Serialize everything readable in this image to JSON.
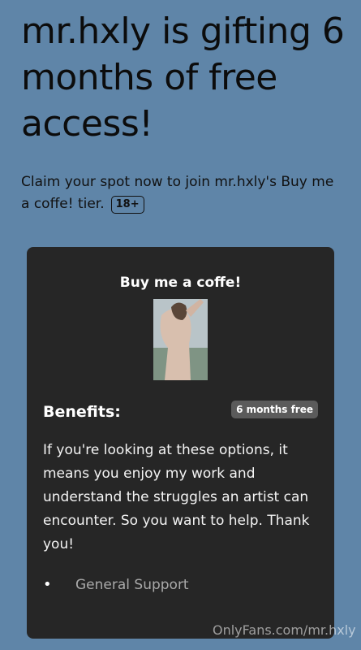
{
  "promo": {
    "headline": "mr.hxly is gifting 6 months of free access!",
    "subtext": "Claim your spot now to join mr.hxly's Buy me a coffe! tier.",
    "age_badge": "18+"
  },
  "tier_card": {
    "title": "Buy me a coffe!",
    "benefits_heading": "Benefits:",
    "months_badge": "6 months free",
    "description": "If you're looking at these options, it means you enjoy my work and understand the struggles an artist can encounter. So you want to help. Thank you!",
    "benefits": [
      "General Support"
    ],
    "bullet": "•"
  },
  "watermark": "OnlyFans.com/mr.hxly",
  "colors": {
    "background": "#5f85a8",
    "card": "#262626",
    "badge": "#5b5b5b"
  }
}
